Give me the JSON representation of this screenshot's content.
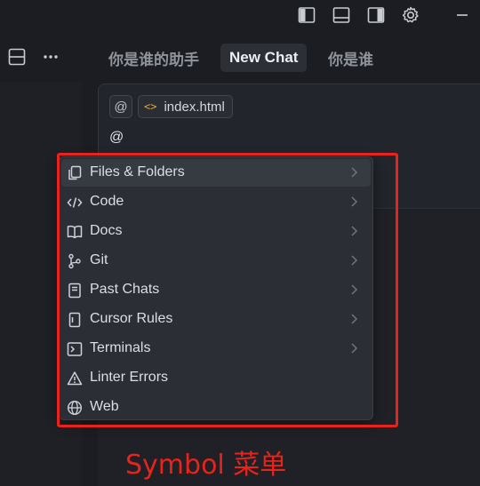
{
  "window_toolbar": {
    "icons": [
      "toggle-left-panel-icon",
      "toggle-bottom-panel-icon",
      "toggle-right-panel-icon",
      "settings-gear-icon",
      "minimize-icon"
    ]
  },
  "sidebar": {
    "icons": [
      "split-view-icon",
      "more-options-icon"
    ]
  },
  "tabs": [
    {
      "label": "你是谁的助手",
      "active": false
    },
    {
      "label": "New Chat",
      "active": true
    },
    {
      "label": "你是谁",
      "active": false
    }
  ],
  "composer": {
    "mention_chip": "@",
    "file_chip": {
      "icon": "code-file-icon",
      "name": "index.html"
    },
    "input_text": "@"
  },
  "symbol_menu": {
    "items": [
      {
        "label": "Files & Folders",
        "icon": "files-icon",
        "has_submenu": true,
        "selected": true
      },
      {
        "label": "Code",
        "icon": "code-icon",
        "has_submenu": true,
        "selected": false
      },
      {
        "label": "Docs",
        "icon": "book-icon",
        "has_submenu": true,
        "selected": false
      },
      {
        "label": "Git",
        "icon": "git-branch-icon",
        "has_submenu": true,
        "selected": false
      },
      {
        "label": "Past Chats",
        "icon": "chat-history-icon",
        "has_submenu": true,
        "selected": false
      },
      {
        "label": "Cursor Rules",
        "icon": "rules-file-icon",
        "has_submenu": true,
        "selected": false
      },
      {
        "label": "Terminals",
        "icon": "terminal-icon",
        "has_submenu": true,
        "selected": false
      },
      {
        "label": "Linter Errors",
        "icon": "warning-icon",
        "has_submenu": false,
        "selected": false
      },
      {
        "label": "Web",
        "icon": "globe-icon",
        "has_submenu": false,
        "selected": false
      }
    ]
  },
  "annotation": {
    "label": "Symbol 菜单",
    "color": "#e8231b"
  }
}
